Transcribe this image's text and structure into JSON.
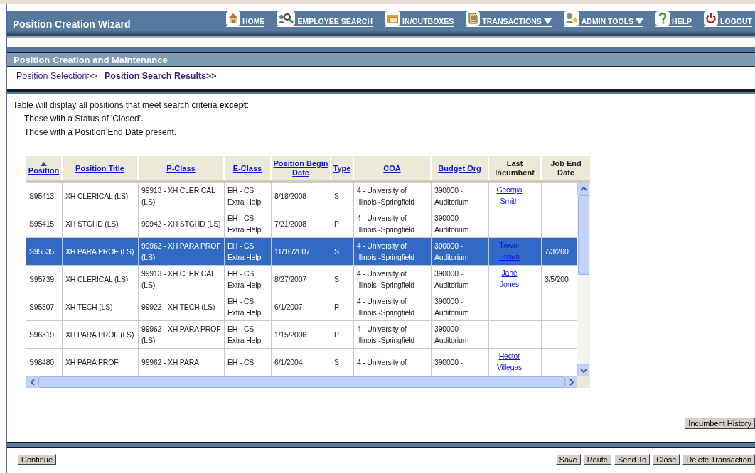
{
  "window": {
    "title": "Position Creation Wizard"
  },
  "nav": [
    {
      "label": "HOME",
      "dropdown": false
    },
    {
      "label": "EMPLOYEE SEARCH",
      "dropdown": false
    },
    {
      "label": "IN/OUTBOXES",
      "dropdown": false
    },
    {
      "label": "TRANSACTIONS",
      "dropdown": true
    },
    {
      "label": "ADMIN TOOLS",
      "dropdown": true
    },
    {
      "label": "HELP",
      "dropdown": false
    },
    {
      "label": "LOGOUT",
      "dropdown": false
    }
  ],
  "section": {
    "title": "Position Creation and Maintenance"
  },
  "breadcrumbs": [
    {
      "label": "Position Selection>>",
      "selected": false
    },
    {
      "label": "Position Search Results>>",
      "selected": true
    }
  ],
  "intro": {
    "text": "Table will display all positions that meet search criteria **except**:",
    "notes": [
      "Those with a Status of 'Closed'.",
      "Those with a Position End Date present."
    ]
  },
  "table": {
    "columns": [
      {
        "label": "Position",
        "link": true,
        "sorted": true
      },
      {
        "label": "Position Title",
        "link": true,
        "sorted": false
      },
      {
        "label": "P-Class",
        "link": true,
        "sorted": false
      },
      {
        "label": "E-Class",
        "link": true,
        "sorted": false
      },
      {
        "label": "Position Begin Date",
        "link": true,
        "sorted": false
      },
      {
        "label": "Type",
        "link": true,
        "sorted": false
      },
      {
        "label": "COA",
        "link": true,
        "sorted": false
      },
      {
        "label": "Budget Org",
        "link": true,
        "sorted": false
      },
      {
        "label": "Last Incumbent",
        "link": false,
        "sorted": false
      },
      {
        "label": "Job End Date",
        "link": false,
        "sorted": false
      }
    ],
    "rows": [
      {
        "selected": false,
        "cells": [
          "S95413",
          "XH CLERICAL (LS)",
          "99913 - XH CLERICAL (LS)",
          "EH - CS Extra Help",
          "8/18/2008",
          "S",
          "4 - University of Illinois -Springfield",
          "390000 - Auditorium",
          "Georgia Smith",
          ""
        ]
      },
      {
        "selected": false,
        "cells": [
          "S95415",
          "XH STGHD (LS)",
          "99942 - XH STGHD (LS)",
          "EH - CS Extra Help",
          "7/21/2008",
          "P",
          "4 - University of Illinois -Springfield",
          "390000 - Auditorium",
          "",
          ""
        ]
      },
      {
        "selected": true,
        "cells": [
          "S95535",
          "XH PARA PROF (LS)",
          "99962 - XH PARA PROF (LS)",
          "EH - CS Extra Help",
          "11/16/2007",
          "S",
          "4 - University of Illinois -Springfield",
          "390000 - Auditorium",
          "Trevor Brown",
          "7/3/200"
        ]
      },
      {
        "selected": false,
        "cells": [
          "S95739",
          "XH CLERICAL (LS)",
          "99913 - XH CLERICAL (LS)",
          "EH - CS Extra Help",
          "8/27/2007",
          "S",
          "4 - University of Illinois -Springfield",
          "390000 - Auditorium",
          "Jane Jones",
          "3/5/200"
        ]
      },
      {
        "selected": false,
        "cells": [
          "S95807",
          "XH TECH (LS)",
          "99922 - XH TECH (LS)",
          "EH - CS Extra Help",
          "6/1/2007",
          "P",
          "4 - University of Illinois -Springfield",
          "390000 - Auditorium",
          "",
          ""
        ]
      },
      {
        "selected": false,
        "cells": [
          "S96319",
          "XH PARA PROF (LS)",
          "99962 - XH PARA PROF (LS)",
          "EH - CS Extra Help",
          "1/15/2006",
          "P",
          "4 - University of Illinois -Springfield",
          "390000 - Auditorium",
          "",
          ""
        ]
      },
      {
        "selected": false,
        "cells": [
          "S98480",
          "XH PARA PROF",
          "99962 - XH PARA",
          "EH - CS",
          "6/1/2004",
          "S",
          "4 - University of",
          "390000 -",
          "Hector Villegas",
          ""
        ]
      }
    ]
  },
  "side_button": "Incumbent History",
  "footer": {
    "left_buttons": [
      "Continue"
    ],
    "right_buttons": [
      "Save",
      "Route",
      "Send To",
      "Close",
      "Delete Transaction"
    ]
  }
}
